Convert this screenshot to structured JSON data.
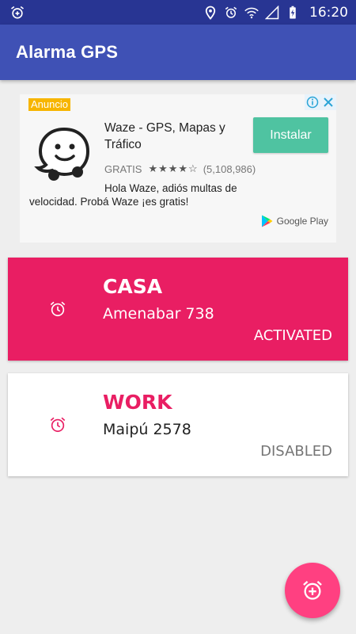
{
  "status_bar": {
    "time": "16:20",
    "left_icon": "alarm-add-icon",
    "right_icons": [
      "location-icon",
      "alarm-icon",
      "wifi-icon",
      "signal-icon",
      "battery-charging-icon"
    ]
  },
  "app_bar": {
    "title": "Alarma GPS",
    "color": "#3f51b5"
  },
  "ad": {
    "badge": "Anuncio",
    "title": "Waze - GPS, Mapas y Tráfico",
    "install_label": "Instalar",
    "price": "GRATIS",
    "rating_stars": "★★★★☆",
    "reviews": "(5,108,986)",
    "description": "Hola Waze, adiós multas de velocidad. Probá Waze ¡es gratis!",
    "store": "Google Play",
    "install_color": "#4fc3a1"
  },
  "alarms": [
    {
      "name": "CASA",
      "address": "Amenabar 738",
      "status": "ACTIVATED",
      "icon": "alarm-icon"
    },
    {
      "name": "WORK",
      "address": "Maipú 2578",
      "status": "DISABLED",
      "icon": "alarm-icon"
    }
  ],
  "colors": {
    "accent": "#e91e63",
    "fab": "#ff4081",
    "status_bar": "#283593"
  },
  "fab": {
    "icon": "alarm-add-icon"
  }
}
